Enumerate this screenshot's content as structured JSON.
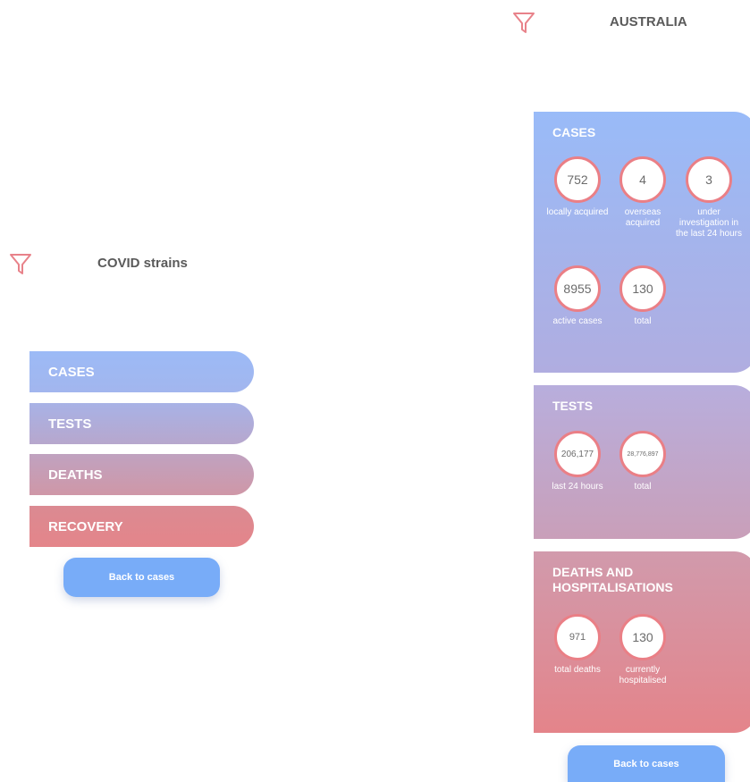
{
  "left_screen": {
    "title": "COVID strains",
    "menu": [
      {
        "label": "CASES"
      },
      {
        "label": "TESTS"
      },
      {
        "label": "DEATHS"
      },
      {
        "label": "RECOVERY"
      }
    ],
    "back_label": "Back to cases"
  },
  "right_screen": {
    "title": "AUSTRALIA",
    "cases": {
      "title": "CASES",
      "stats": [
        {
          "value": "752",
          "label": "locally acquired"
        },
        {
          "value": "4",
          "label": "overseas acquired"
        },
        {
          "value": "3",
          "label": "under investigation in the last 24 hours"
        },
        {
          "value": "8955",
          "label": "active cases"
        },
        {
          "value": "130",
          "label": "total"
        }
      ]
    },
    "tests": {
      "title": "TESTS",
      "stats": [
        {
          "value": "206,177",
          "label": "last 24 hours"
        },
        {
          "value": "28,776,897",
          "label": "total"
        }
      ]
    },
    "deaths": {
      "title": "DEATHS AND HOSPITALISATIONS",
      "stats": [
        {
          "value": "971",
          "label": "total deaths"
        },
        {
          "value": "130",
          "label": "currently hospitalised"
        }
      ]
    },
    "back_label": "Back to cases"
  },
  "colors": {
    "accent_red": "#e8828a",
    "gradient_blue": "#99bbf8",
    "gradient_pink": "#e48489",
    "button_blue": "#78acf8"
  },
  "icons": [
    "filter-icon"
  ]
}
